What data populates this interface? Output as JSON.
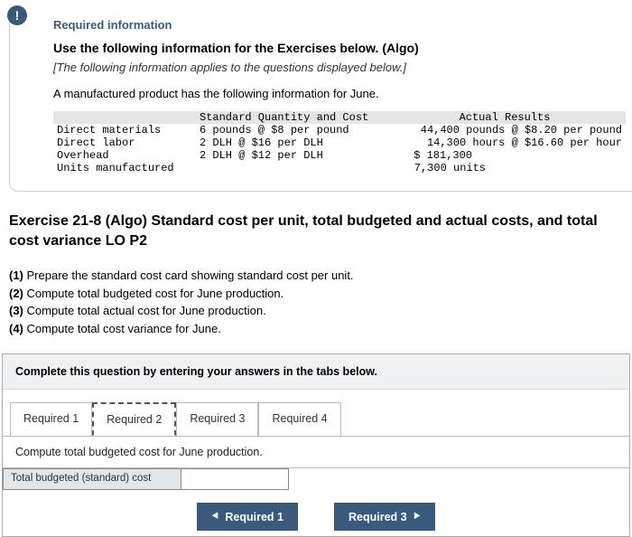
{
  "alert_glyph": "!",
  "required_heading": "Required information",
  "use_following": "Use the following information for the Exercises below. (Algo)",
  "italics_info": "[The following information applies to the questions displayed below.]",
  "intro": "A manufactured product has the following information for June.",
  "table": {
    "header_mid": "Standard Quantity and Cost",
    "header_right": "Actual Results",
    "rows": [
      {
        "label": "Direct materials",
        "std": "6 pounds @ $8 per pound",
        "act": "44,400 pounds @ $8.20 per pound"
      },
      {
        "label": "Direct labor",
        "std": "2 DLH @ $16 per DLH",
        "act": "14,300 hours @ $16.60 per hour"
      },
      {
        "label": "Overhead",
        "std": "2 DLH @ $12 per DLH",
        "act": "$ 181,300"
      },
      {
        "label": "Units manufactured",
        "std": "",
        "act": "7,300 units"
      }
    ]
  },
  "exercise_title": "Exercise 21-8 (Algo) Standard cost per unit, total budgeted and actual costs, and total cost variance LO P2",
  "tasks": [
    {
      "num": "(1)",
      "text": " Prepare the standard cost card showing standard cost per unit."
    },
    {
      "num": "(2)",
      "text": " Compute total budgeted cost for June production."
    },
    {
      "num": "(3)",
      "text": " Compute total actual cost for June production."
    },
    {
      "num": "(4)",
      "text": " Compute total cost variance for June."
    }
  ],
  "answer_head": "Complete this question by entering your answers in the tabs below.",
  "tabs": [
    "Required 1",
    "Required 2",
    "Required 3",
    "Required 4"
  ],
  "sub_instruction": "Compute total budgeted cost for June production.",
  "entry_label": "Total budgeted (standard) cost",
  "nav_prev": "Required 1",
  "nav_next": "Required 3"
}
